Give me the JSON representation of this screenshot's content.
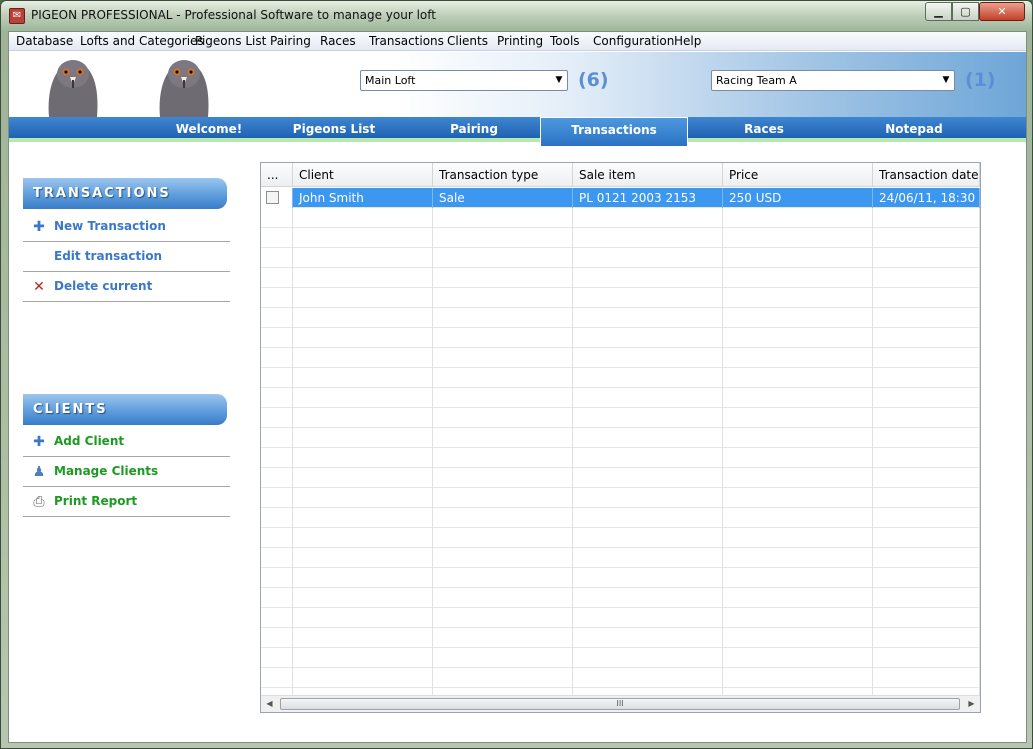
{
  "window": {
    "title": "PIGEON PROFESSIONAL - Professional Software to manage your loft",
    "controls": {
      "minimize": "▁",
      "maximize": "▢",
      "close": "✕"
    }
  },
  "menu": [
    "Database",
    "Lofts and Categories",
    "Pigeons List",
    "Pairing",
    "Races",
    "Transactions",
    "Clients",
    "Printing",
    "Tools",
    "Configuration",
    "Help"
  ],
  "header": {
    "loft_select": "Main Loft",
    "loft_count": "(6)",
    "team_select": "Racing Team A",
    "team_count": "(1)"
  },
  "tabs": [
    "Welcome!",
    "Pigeons List",
    "Pairing",
    "Transactions",
    "Races",
    "Notepad"
  ],
  "active_tab": "Transactions",
  "sidebar": {
    "transactions_title": "TRANSACTIONS",
    "transactions_links": [
      {
        "label": "New Transaction",
        "icon": "plus-icon"
      },
      {
        "label": "Edit transaction",
        "icon": ""
      },
      {
        "label": "Delete current",
        "icon": "delete-x-icon"
      }
    ],
    "clients_title": "CLIENTS",
    "clients_links": [
      {
        "label": "Add Client",
        "icon": "plus-icon"
      },
      {
        "label": "Manage Clients",
        "icon": "user-icon"
      },
      {
        "label": "Print Report",
        "icon": "printer-icon"
      }
    ]
  },
  "grid": {
    "columns": [
      "...",
      "Client",
      "Transaction type",
      "Sale item",
      "Price",
      "Transaction date"
    ],
    "rows": [
      {
        "client": "John Smith",
        "type": "Sale",
        "item": "PL 0121 2003 2153",
        "price": "250 USD",
        "date": "24/06/11, 18:30"
      }
    ],
    "scroll_thumb": "III"
  },
  "colors": {
    "accent": "#2a72c3",
    "link_blue": "#3b78c8",
    "link_green": "#1c9a23",
    "selection": "#3c97f0"
  }
}
